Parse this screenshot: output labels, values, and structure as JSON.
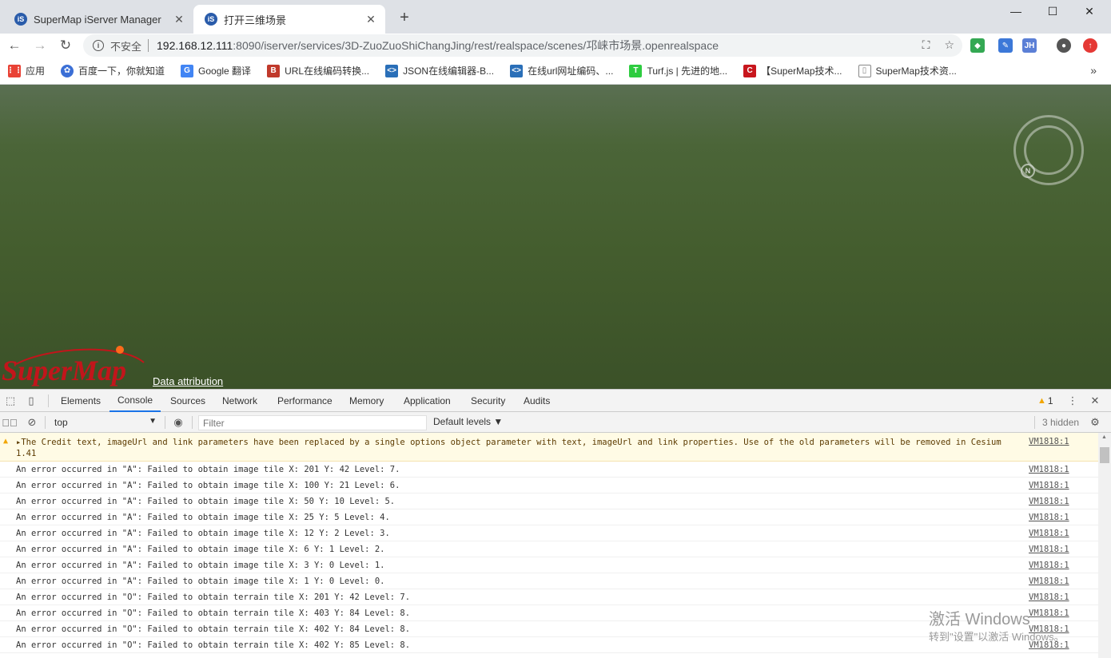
{
  "tabs": [
    {
      "title": "SuperMap iServer Manager",
      "favicon": "iS"
    },
    {
      "title": "打开三维场景",
      "favicon": "iS"
    }
  ],
  "window_controls": [
    "minimize-icon",
    "maximize-icon",
    "close-icon"
  ],
  "address": {
    "security_label": "不安全",
    "host": "192.168.12.111",
    "path": ":8090/iserver/services/3D-ZuoZuoShiChangJing/rest/realspace/scenes/邛崃市场景.openrealspace"
  },
  "bookmarks": [
    {
      "label": "应用",
      "icon": "apps-grid-icon",
      "color": "#e94235"
    },
    {
      "label": "百度一下，你就知道",
      "icon": "baidu-paw-icon",
      "color": "#3b6fd6"
    },
    {
      "label": "Google 翻译",
      "icon": "google-translate-icon",
      "color": "#4285f4"
    },
    {
      "label": "URL在线编码转换...",
      "icon": "b-icon",
      "color": "#c0392b"
    },
    {
      "label": "JSON在线编辑器-B...",
      "icon": "code-brackets-icon",
      "color": "#2a6fb8"
    },
    {
      "label": "在线url网址编码、...",
      "icon": "code-brackets-icon",
      "color": "#2a6fb8"
    },
    {
      "label": "Turf.js | 先进的地...",
      "icon": "turf-t-icon",
      "color": "#2ecc40"
    },
    {
      "label": "【SuperMap技术...",
      "icon": "csdn-c-icon",
      "color": "#c8161d"
    },
    {
      "label": "SuperMap技术资...",
      "icon": "document-icon",
      "color": "#888888"
    }
  ],
  "viewport": {
    "logo_text": "SuperMap",
    "attribution": "Data attribution",
    "compass_label": "N"
  },
  "devtools": {
    "tabs": [
      "Elements",
      "Console",
      "Sources",
      "Network",
      "Performance",
      "Memory",
      "Application",
      "Security",
      "Audits"
    ],
    "active_tab": "Console",
    "warning_count": "1",
    "context": "top",
    "filter_placeholder": "Filter",
    "levels": "Default levels ▼",
    "hidden": "3 hidden",
    "messages": [
      {
        "type": "warn",
        "text": "▸The Credit text, imageUrl and link parameters have been replaced by a single options object parameter with text, imageUrl and link properties. Use of the old parameters will be removed in Cesium 1.41",
        "src": "VM1818:1"
      },
      {
        "type": "log",
        "text": "An error occurred in \"A\": Failed to obtain image tile X: 201 Y: 42 Level: 7.",
        "src": "VM1818:1"
      },
      {
        "type": "log",
        "text": "An error occurred in \"A\": Failed to obtain image tile X: 100 Y: 21 Level: 6.",
        "src": "VM1818:1"
      },
      {
        "type": "log",
        "text": "An error occurred in \"A\": Failed to obtain image tile X: 50 Y: 10 Level: 5.",
        "src": "VM1818:1"
      },
      {
        "type": "log",
        "text": "An error occurred in \"A\": Failed to obtain image tile X: 25 Y: 5 Level: 4.",
        "src": "VM1818:1"
      },
      {
        "type": "log",
        "text": "An error occurred in \"A\": Failed to obtain image tile X: 12 Y: 2 Level: 3.",
        "src": "VM1818:1"
      },
      {
        "type": "log",
        "text": "An error occurred in \"A\": Failed to obtain image tile X: 6 Y: 1 Level: 2.",
        "src": "VM1818:1"
      },
      {
        "type": "log",
        "text": "An error occurred in \"A\": Failed to obtain image tile X: 3 Y: 0 Level: 1.",
        "src": "VM1818:1"
      },
      {
        "type": "log",
        "text": "An error occurred in \"A\": Failed to obtain image tile X: 1 Y: 0 Level: 0.",
        "src": "VM1818:1"
      },
      {
        "type": "log",
        "text": "An error occurred in \"O\": Failed to obtain terrain tile X: 201 Y: 42 Level: 7.",
        "src": "VM1818:1"
      },
      {
        "type": "log",
        "text": "An error occurred in \"O\": Failed to obtain terrain tile X: 403 Y: 84 Level: 8.",
        "src": "VM1818:1"
      },
      {
        "type": "log",
        "text": "An error occurred in \"O\": Failed to obtain terrain tile X: 402 Y: 84 Level: 8.",
        "src": "VM1818:1"
      },
      {
        "type": "log",
        "text": "An error occurred in \"O\": Failed to obtain terrain tile X: 402 Y: 85 Level: 8.",
        "src": "VM1818:1"
      }
    ]
  },
  "watermark": {
    "line1": "激活 Windows",
    "line2": "转到\"设置\"以激活 Windows。"
  }
}
